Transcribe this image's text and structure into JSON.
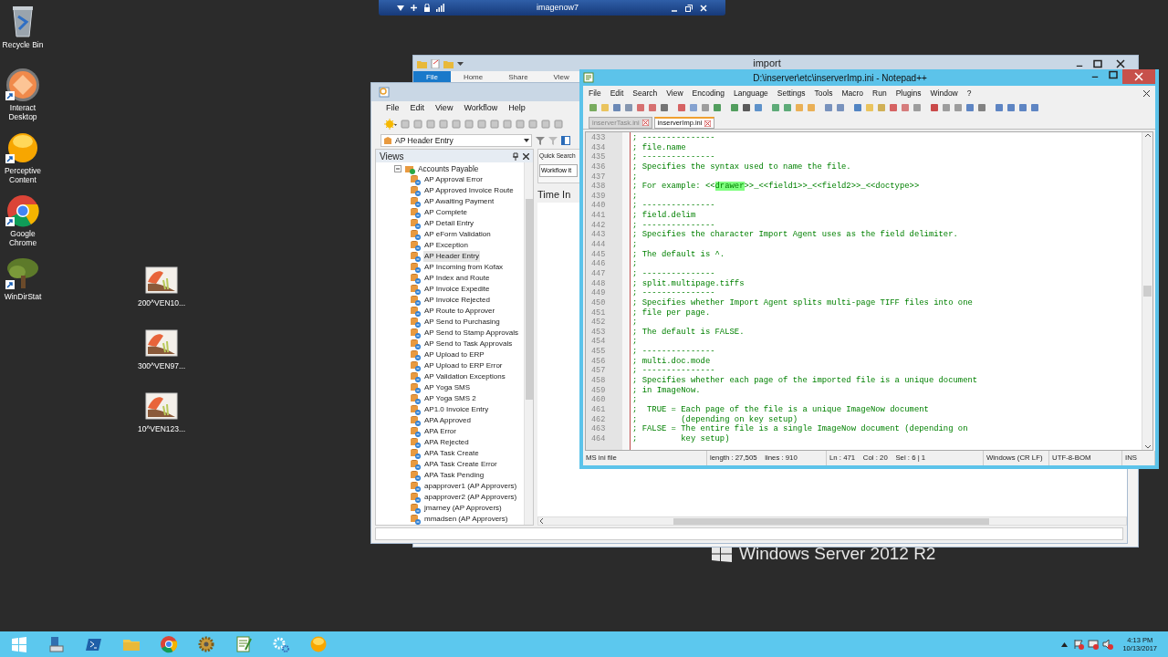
{
  "remote_bar": {
    "title": "imagenow7"
  },
  "desktop_icons": [
    {
      "label": "Recycle Bin",
      "kind": "bin"
    },
    {
      "label": "Interact Desktop",
      "kind": "orb"
    },
    {
      "label": "Perceptive Content",
      "kind": "sphere"
    },
    {
      "label": "Google Chrome",
      "kind": "chrome"
    },
    {
      "label": "WinDirStat",
      "kind": "tree"
    },
    {
      "label": "200^VEN10...",
      "kind": "image"
    },
    {
      "label": "300^VEN97...",
      "kind": "image"
    },
    {
      "label": "10^VEN123...",
      "kind": "image"
    }
  ],
  "wallpaper_text": "Windows Server 2012 R2",
  "explorer": {
    "title": "import",
    "ribbon_tabs": [
      {
        "label": "File",
        "selected": true
      },
      {
        "label": "Home",
        "selected": false
      },
      {
        "label": "Share",
        "selected": false
      },
      {
        "label": "View",
        "selected": false
      }
    ]
  },
  "imagenow": {
    "menu": [
      "File",
      "Edit",
      "View",
      "Workflow",
      "Help"
    ],
    "view_selector": "AP Header Entry",
    "views": {
      "title": "Views",
      "tree": [
        {
          "label": "Accounts Payable",
          "expanded": true,
          "children": [
            {
              "label": "AP Approval Error",
              "selected": false
            },
            {
              "label": "AP Approved Invoice Route",
              "selected": false
            },
            {
              "label": "AP Awaiting Payment",
              "selected": false
            },
            {
              "label": "AP Complete",
              "selected": false
            },
            {
              "label": "AP Detail Entry",
              "selected": false
            },
            {
              "label": "AP eForm Validation",
              "selected": false
            },
            {
              "label": "AP Exception",
              "selected": false
            },
            {
              "label": "AP Header Entry",
              "selected": true
            },
            {
              "label": "AP Incoming from Kofax",
              "selected": false
            },
            {
              "label": "AP Index and Route",
              "selected": false
            },
            {
              "label": "AP Invoice Expedite",
              "selected": false
            },
            {
              "label": "AP Invoice Rejected",
              "selected": false
            },
            {
              "label": "AP Route to Approver",
              "selected": false
            },
            {
              "label": "AP Send to Purchasing",
              "selected": false
            },
            {
              "label": "AP Send to Stamp Approvals",
              "selected": false
            },
            {
              "label": "AP Send to Task Approvals",
              "selected": false
            },
            {
              "label": "AP Upload to ERP",
              "selected": false
            },
            {
              "label": "AP Upload to ERP Error",
              "selected": false
            },
            {
              "label": "AP Validation Exceptions",
              "selected": false
            },
            {
              "label": "AP Yoga SMS",
              "selected": false
            },
            {
              "label": "AP Yoga SMS 2",
              "selected": false
            },
            {
              "label": "AP1.0 Invoice Entry",
              "selected": false
            },
            {
              "label": "APA Approved",
              "selected": false
            },
            {
              "label": "APA Error",
              "selected": false
            },
            {
              "label": "APA Rejected",
              "selected": false
            },
            {
              "label": "APA Task Create",
              "selected": false
            },
            {
              "label": "APA Task Create Error",
              "selected": false
            },
            {
              "label": "APA Task Pending",
              "selected": false
            },
            {
              "label": "apapprover1 (AP Approvers)",
              "selected": false
            },
            {
              "label": "apapprover2 (AP Approvers)",
              "selected": false
            },
            {
              "label": "jmarney (AP Approvers)",
              "selected": false
            },
            {
              "label": "mmadsen (AP Approvers)",
              "selected": false
            }
          ]
        }
      ]
    },
    "quick_search": {
      "tab": "Quick Search",
      "field": "Workflow it"
    },
    "pane_heading": "Time In"
  },
  "notepad": {
    "title": "D:\\inserver\\etc\\inserverImp.ini - Notepad++",
    "menu": [
      "File",
      "Edit",
      "Search",
      "View",
      "Encoding",
      "Language",
      "Settings",
      "Tools",
      "Macro",
      "Run",
      "Plugins",
      "Window",
      "?"
    ],
    "tabs": [
      {
        "label": "inserverTask.ini",
        "selected": false
      },
      {
        "label": "inserverImp.ini",
        "selected": true
      }
    ],
    "lines": [
      {
        "num": "433",
        "text": "; ---------------"
      },
      {
        "num": "434",
        "text": "; file.name"
      },
      {
        "num": "435",
        "text": "; ---------------"
      },
      {
        "num": "436",
        "text": "; Specifies the syntax used to name the file."
      },
      {
        "num": "437",
        "text": ";"
      },
      {
        "num": "438",
        "text": "; For example: <<",
        "mark": "drawer",
        "after": ">>_<<field1>>_<<field2>>_<<doctype>>"
      },
      {
        "num": "439",
        "text": ";"
      },
      {
        "num": "440",
        "text": "; ---------------"
      },
      {
        "num": "441",
        "text": "; field.delim"
      },
      {
        "num": "442",
        "text": "; ---------------"
      },
      {
        "num": "443",
        "text": "; Specifies the character Import Agent uses as the field delimiter."
      },
      {
        "num": "444",
        "text": ";"
      },
      {
        "num": "445",
        "text": "; The default is ^."
      },
      {
        "num": "446",
        "text": ";"
      },
      {
        "num": "447",
        "text": "; ---------------"
      },
      {
        "num": "448",
        "text": "; split.multipage.tiffs"
      },
      {
        "num": "449",
        "text": "; ---------------"
      },
      {
        "num": "450",
        "text": "; Specifies whether Import Agent splits multi-page TIFF files into one"
      },
      {
        "num": "451",
        "text": "; file per page."
      },
      {
        "num": "452",
        "text": ";"
      },
      {
        "num": "453",
        "text": "; The default is FALSE."
      },
      {
        "num": "454",
        "text": ";"
      },
      {
        "num": "455",
        "text": "; ---------------"
      },
      {
        "num": "456",
        "text": "; multi.doc.mode"
      },
      {
        "num": "457",
        "text": "; ---------------"
      },
      {
        "num": "458",
        "text": "; Specifies whether each page of the imported file is a unique document"
      },
      {
        "num": "459",
        "text": "; in ImageNow."
      },
      {
        "num": "460",
        "text": ";"
      },
      {
        "num": "461",
        "text": ";  TRUE = Each page of the file is a unique ImageNow document"
      },
      {
        "num": "462",
        "text": ";         (depending on key setup)"
      },
      {
        "num": "463",
        "text": "; FALSE = The entire file is a single ImageNow document (depending on"
      },
      {
        "num": "464",
        "text": ";         key setup)"
      }
    ],
    "status": [
      "MS ini file",
      "length : 27,505    lines : 910",
      "Ln : 471    Col : 20    Sel : 6 | 1",
      "Windows (CR LF)",
      "UTF-8-BOM",
      "INS"
    ]
  },
  "taskbar": {
    "items": [
      {
        "kind": "start"
      },
      {
        "kind": "server"
      },
      {
        "kind": "shell"
      },
      {
        "kind": "folder"
      },
      {
        "kind": "chrome"
      },
      {
        "kind": "gearbox"
      },
      {
        "kind": "notepad"
      },
      {
        "kind": "settings"
      },
      {
        "kind": "sphere"
      }
    ],
    "time": "4:13 PM",
    "date": "10/13/2017"
  }
}
